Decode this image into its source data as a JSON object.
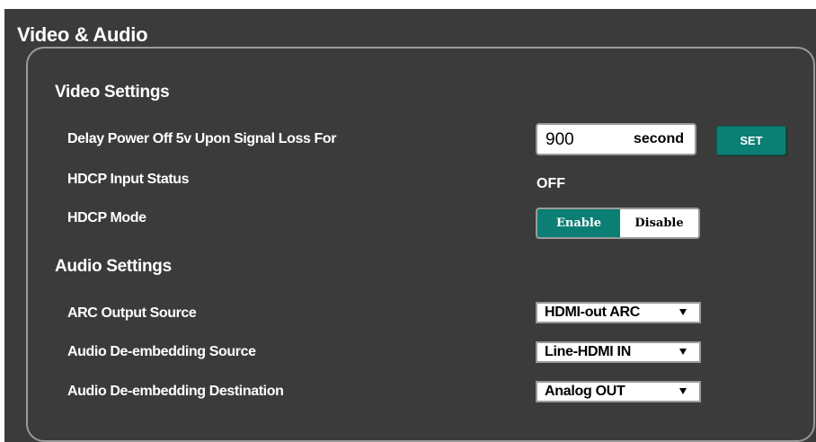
{
  "section": {
    "title": "Video & Audio"
  },
  "video_settings": {
    "title": "Video Settings",
    "delay_power_off": {
      "label": "Delay Power Off 5v Upon Signal Loss For",
      "value": "900",
      "unit": "second",
      "set_label": "SET"
    },
    "hdcp_input_status": {
      "label": "HDCP Input Status",
      "value": "OFF"
    },
    "hdcp_mode": {
      "label": "HDCP Mode",
      "options": [
        "Enable",
        "Disable"
      ],
      "selected": "Enable"
    }
  },
  "audio_settings": {
    "title": "Audio Settings",
    "arc_output_source": {
      "label": "ARC Output Source",
      "value": "HDMI-out ARC"
    },
    "de_embedding_source": {
      "label": "Audio De-embedding Source",
      "value": "Line-HDMI IN"
    },
    "de_embedding_destination": {
      "label": "Audio De-embedding Destination",
      "value": "Analog OUT"
    }
  },
  "colors": {
    "background": "#3b3b3b",
    "accent": "#0b7f73",
    "border": "#9a9a9a"
  },
  "icons": {
    "dropdown": "triangle-down"
  }
}
